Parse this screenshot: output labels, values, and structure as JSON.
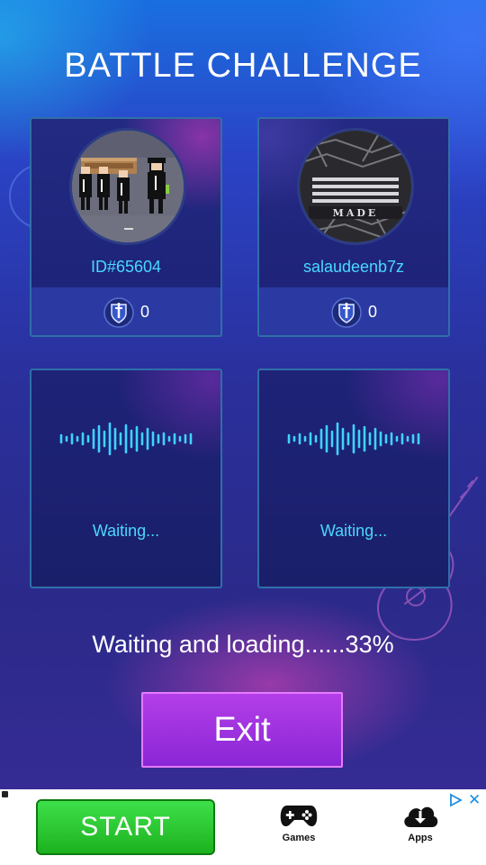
{
  "title": "BATTLE CHALLENGE",
  "players": [
    {
      "name": "ID#65604",
      "score": "0",
      "avatar_icon": "pallbearers-avatar-icon"
    },
    {
      "name": "salaudeenb7z",
      "score": "0",
      "avatar_icon": "made-album-avatar-icon"
    }
  ],
  "status": {
    "left_text": "Waiting...",
    "right_text": "Waiting...",
    "wave_icon": "sound-wave-icon"
  },
  "loading": {
    "text": "Waiting and loading......33%",
    "progress_percent": 33
  },
  "exit_label": "Exit",
  "ad": {
    "start_label": "START",
    "games_label": "Games",
    "apps_label": "Apps",
    "close_label": "✕"
  },
  "colors": {
    "accent_cyan": "#49d8ff",
    "exit_purple": "#a233e0",
    "start_green": "#2bcf35"
  }
}
